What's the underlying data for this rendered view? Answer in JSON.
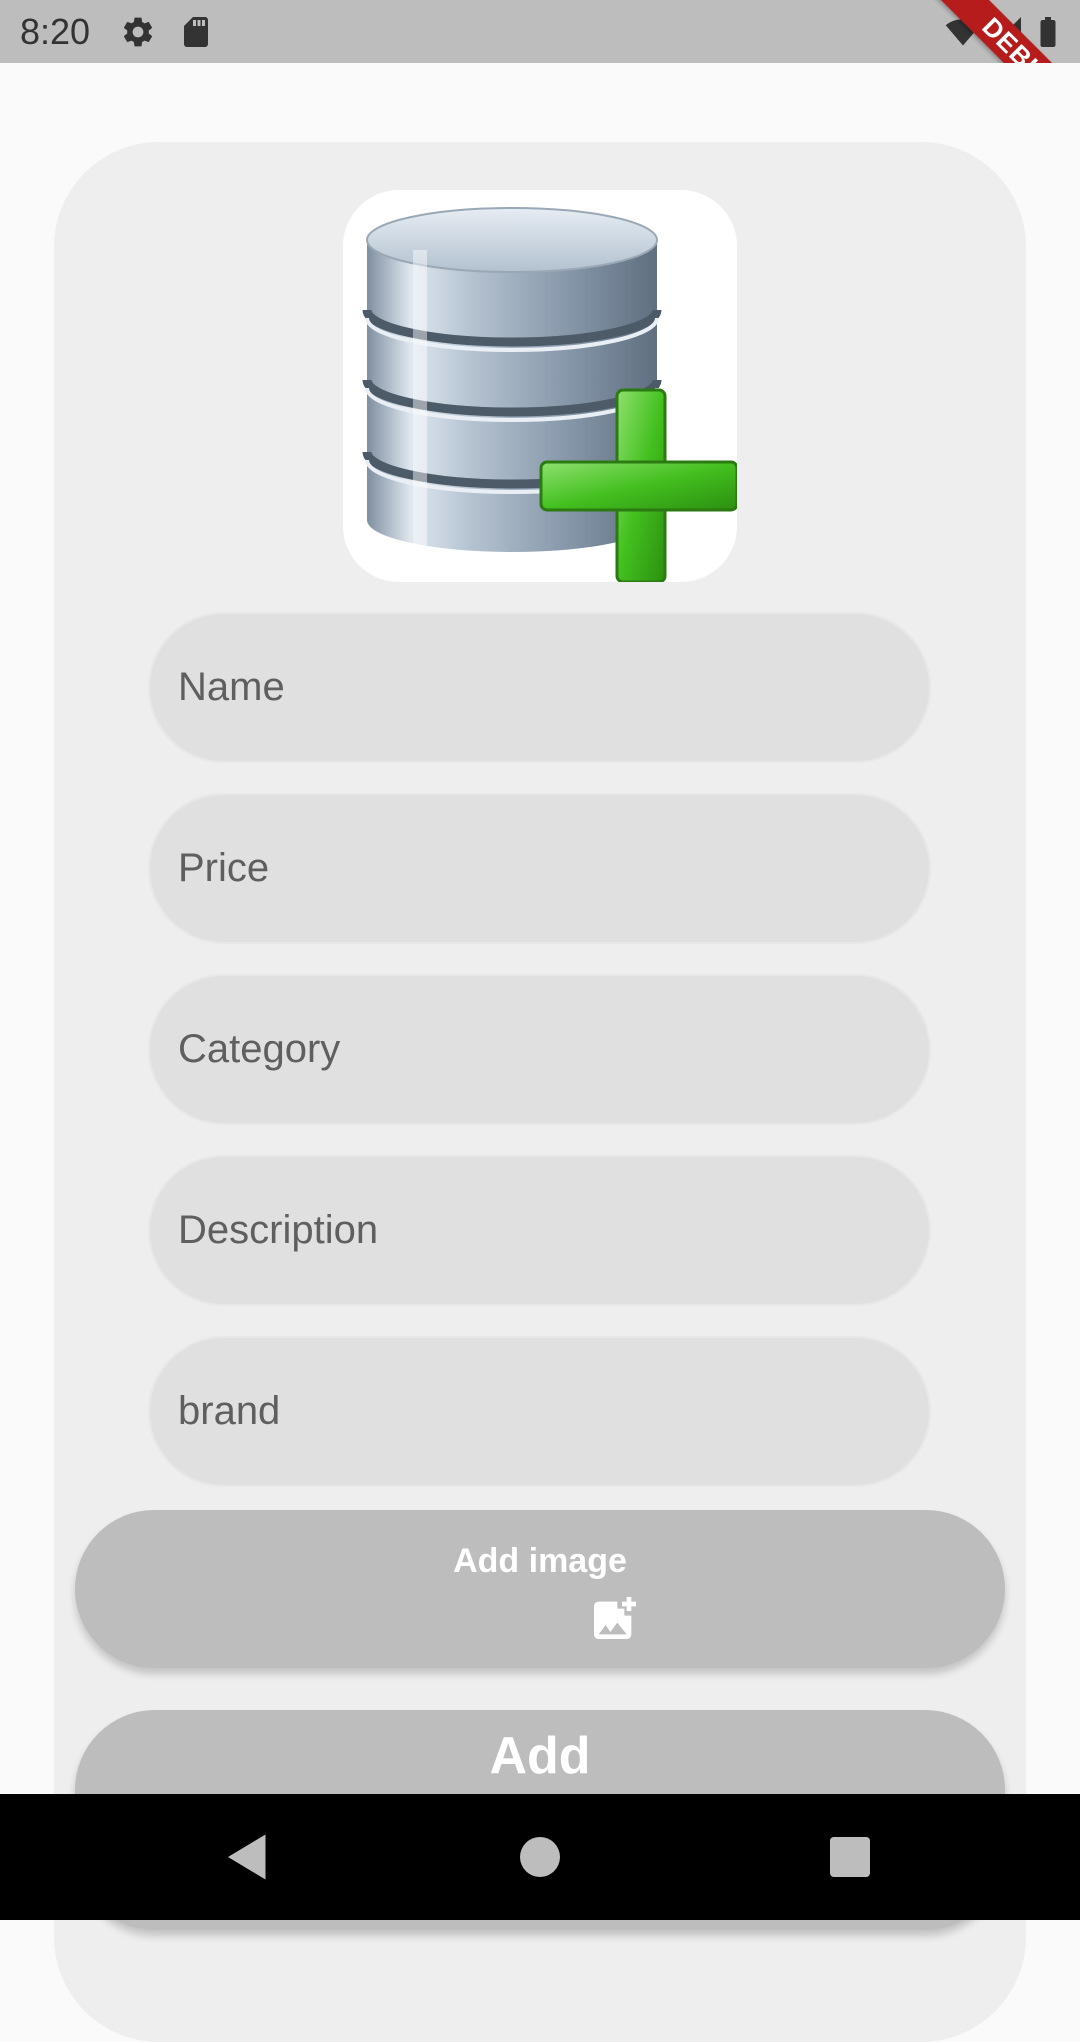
{
  "status_bar": {
    "time": "8:20",
    "icons": [
      "gear-icon",
      "sd-card-icon",
      "wifi-icon",
      "signal-icon",
      "battery-icon"
    ]
  },
  "debug_banner": {
    "label": "DEBUG"
  },
  "form": {
    "image_icon": "database-add-icon",
    "fields": [
      {
        "placeholder": "Name"
      },
      {
        "placeholder": "Price"
      },
      {
        "placeholder": "Category"
      },
      {
        "placeholder": "Description"
      },
      {
        "placeholder": "brand"
      }
    ],
    "add_image_button": {
      "label": "Add image",
      "icon": "add-photo-icon"
    },
    "add_button": {
      "label": "Add"
    }
  },
  "nav_bar": {
    "items": [
      "back-icon",
      "home-icon",
      "recents-icon"
    ]
  },
  "colors": {
    "status_bar": "#bdbdbd",
    "card": "#eeeeee",
    "field": "#e0e0e0",
    "button": "#bdbdbd",
    "debug": "#b71c1c",
    "nav_bar": "#000000"
  }
}
